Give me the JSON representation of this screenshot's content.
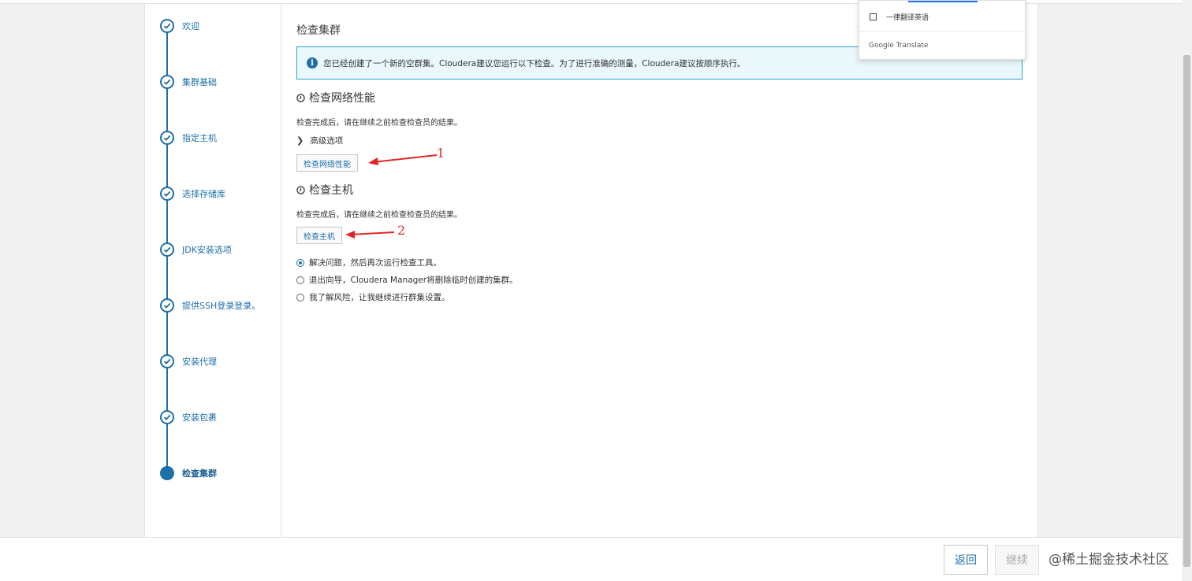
{
  "steps": [
    {
      "label": "欢迎"
    },
    {
      "label": "集群基础"
    },
    {
      "label": "指定主机"
    },
    {
      "label": "选择存储库"
    },
    {
      "label": "JDK安装选项"
    },
    {
      "label": "提供SSH登录登录。"
    },
    {
      "label": "安装代理"
    },
    {
      "label": "安装包裹"
    },
    {
      "label": "检查集群"
    }
  ],
  "main": {
    "title": "检查集群",
    "alert": "您已经创建了一个新的空群集。Cloudera建议您运行以下检查。为了进行准确的测量，Cloudera建议按顺序执行。",
    "network": {
      "title": "检查网络性能",
      "desc": "检查完成后，请在继续之前检查检查员的结果。",
      "advanced": "高级选项",
      "button": "检查网络性能"
    },
    "hosts": {
      "title": "检查主机",
      "desc": "检查完成后，请在继续之前检查检查员的结果。",
      "button": "检查主机"
    },
    "options": [
      {
        "label": "解决问题，然后再次运行检查工具。",
        "checked": true
      },
      {
        "label": "退出向导，Cloudera Manager将删除临时创建的集群。",
        "checked": false
      },
      {
        "label": "我了解风险，让我继续进行群集设置。",
        "checked": false
      }
    ]
  },
  "annotations": {
    "one": "1",
    "two": "2"
  },
  "translate_popup": {
    "always_translate": "一律翻译英语",
    "brand": "Google Translate"
  },
  "footer": {
    "back": "返回",
    "next": "继续",
    "watermark": "@稀土掘金技术社区"
  },
  "colors": {
    "accent": "#1e6fa8",
    "annotation": "#e32424",
    "alert_border": "#2aa4c8"
  }
}
